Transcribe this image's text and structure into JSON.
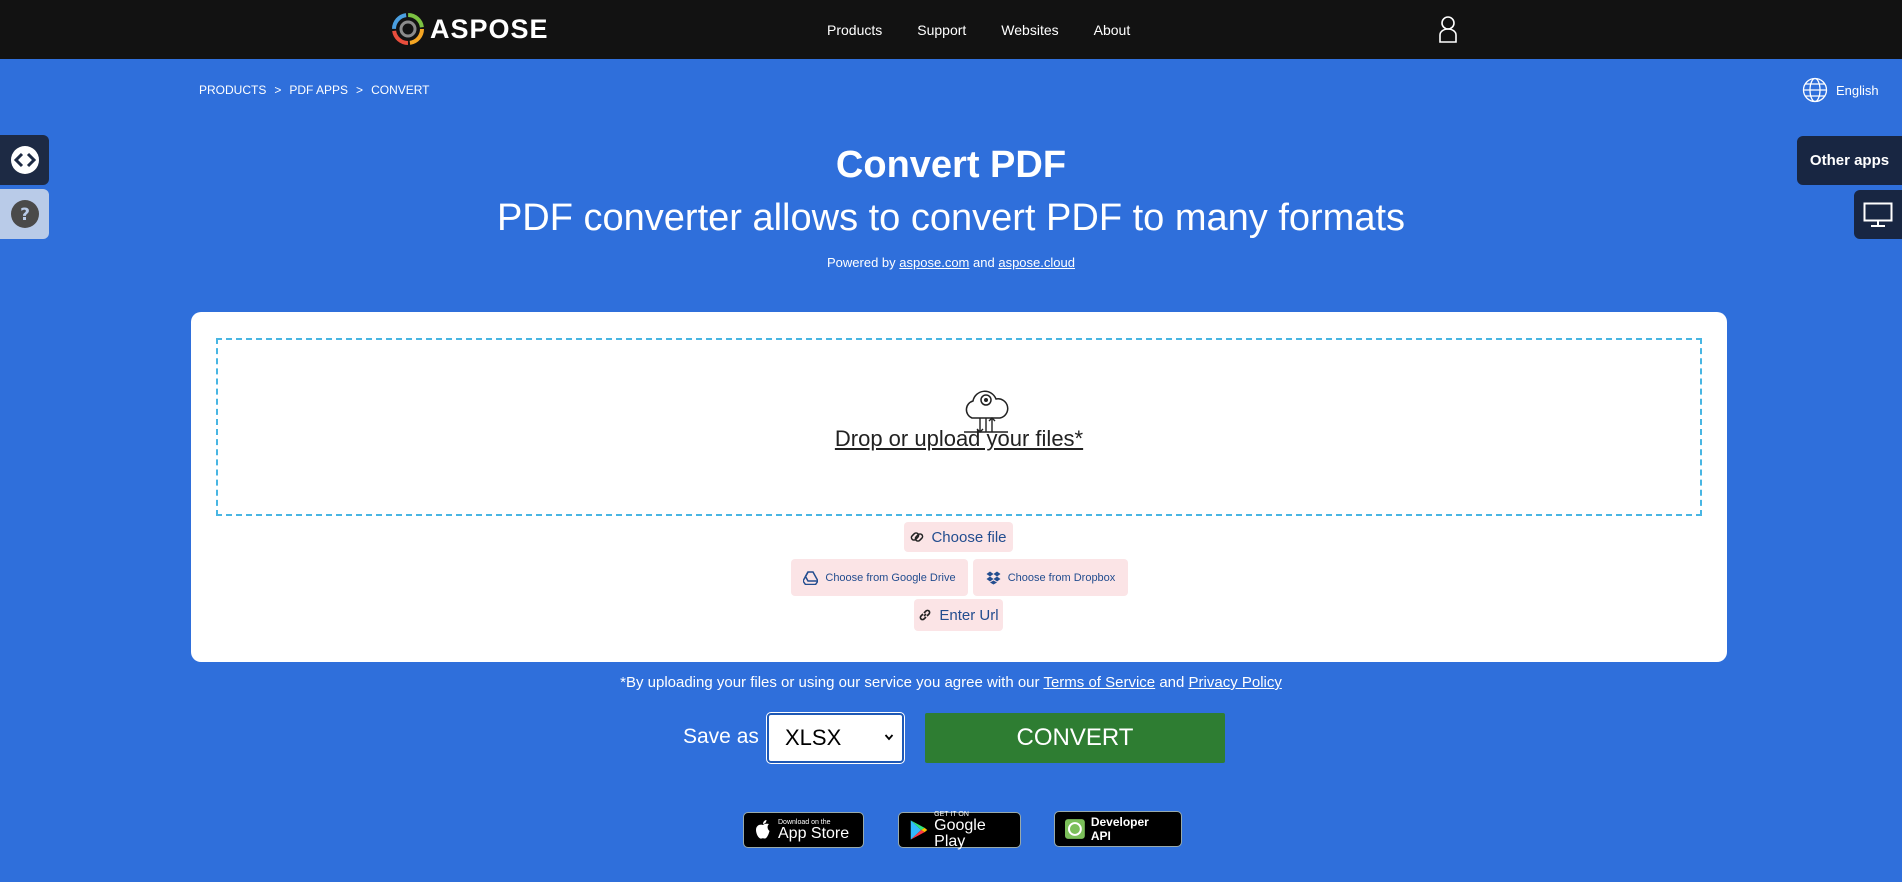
{
  "header": {
    "logo_text": "ASPOSE",
    "nav": [
      "Products",
      "Support",
      "Websites",
      "About"
    ]
  },
  "breadcrumb": [
    "PRODUCTS",
    ">",
    "PDF APPS",
    ">",
    "CONVERT"
  ],
  "language": "English",
  "side": {
    "other_apps": "Other apps"
  },
  "hero": {
    "title": "Convert PDF",
    "subtitle": "PDF converter allows to convert PDF to many formats",
    "powered_prefix": "Powered by",
    "powered_link1": "aspose.com",
    "powered_and": "and",
    "powered_link2": "aspose.cloud"
  },
  "upload": {
    "drop_text": "Drop or upload your files*",
    "choose_file": "Choose file",
    "google_drive": "Choose from Google Drive",
    "dropbox": "Choose from Dropbox",
    "enter_url": "Enter Url"
  },
  "terms": {
    "prefix": "*By uploading your files or using our service you agree with our",
    "tos": "Terms of Service",
    "and": "and",
    "privacy": "Privacy Policy"
  },
  "save": {
    "label": "Save as",
    "format": "XLSX",
    "convert": "CONVERT"
  },
  "badges": {
    "appstore_small": "Download on the",
    "appstore_big": "App Store",
    "play_small": "GET IT ON",
    "play_big": "Google Play",
    "api": "Developer API"
  },
  "colors": {
    "background": "#2f6fdb",
    "topbar": "#121212",
    "convert": "#2e7d32",
    "pill": "#fbe4e6",
    "dropzone_border": "#48b6e3"
  }
}
